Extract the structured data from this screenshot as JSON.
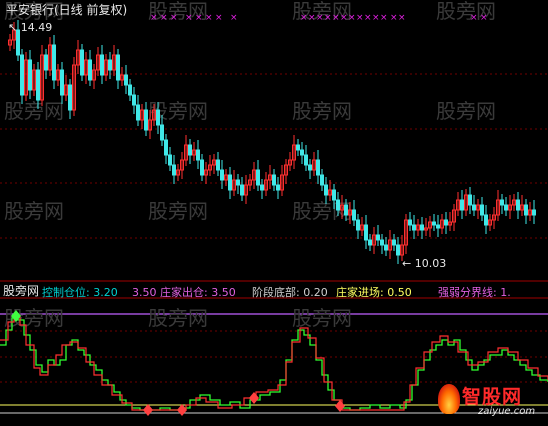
{
  "upper_panel": {
    "title": "平安银行(日线 前复权)",
    "high_marker": "14.49",
    "low_marker": "10.03",
    "watermark": "股旁网"
  },
  "indicator_panel": {
    "brand": "股旁网",
    "fields": [
      {
        "label": "控制仓位:",
        "value": "3.20",
        "color": "#00d0d0"
      },
      {
        "label": "3.50",
        "value": "",
        "color": "#e060e0"
      },
      {
        "label": "庄家出仓:",
        "value": "3.50",
        "color": "#e060e0"
      },
      {
        "label": "阶段底部:",
        "value": "0.20",
        "color": "#d0d0d0"
      },
      {
        "label": "庄家进场:",
        "value": "0.50",
        "color": "#ffff60"
      },
      {
        "label": "强弱分界线:",
        "value": "1.",
        "color": "#e060e0"
      }
    ]
  },
  "logo": {
    "name": "智股网",
    "domain": "zaiyue.com"
  },
  "colors": {
    "up_candle": "#ff3030",
    "down_candle": "#40e8e8",
    "grid": "#700000",
    "signal_x": "#e020e0",
    "line_green": "#30ff30",
    "line_red": "#ff3030"
  }
}
